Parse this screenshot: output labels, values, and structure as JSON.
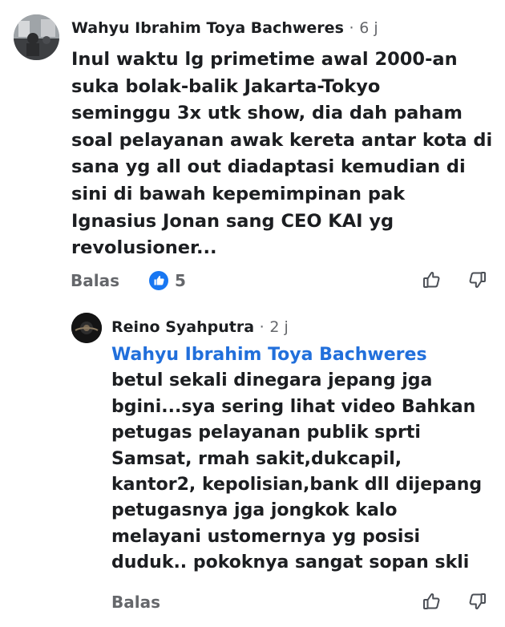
{
  "comments": [
    {
      "author": "Wahyu Ibrahim Toya Bachweres",
      "time": "6 j",
      "lines": [
        "Inul waktu lg primetime awal 2000-an",
        "suka bolak-balik Jakarta-Tokyo",
        "seminggu 3x utk show, dia dah paham",
        "soal pelayanan awak kereta antar kota di",
        "sana yg all out diadaptasi kemudian di",
        "sini di bawah kepemimpinan pak",
        "Ignasius Jonan sang CEO KAI yg",
        "revolusioner..."
      ],
      "reply_label": "Balas",
      "like_count": "5"
    },
    {
      "author": "Reino Syahputra",
      "time": "2 j",
      "mention": "Wahyu Ibrahim Toya Bachweres",
      "lines": [
        "betul sekali dinegara jepang jga",
        "bgini...sya sering lihat video Bahkan",
        "petugas pelayanan publik sprti",
        "Samsat, rmah sakit,dukcapil,",
        "kantor2, kepolisian,bank dll dijepang",
        "petugasnya jga jongkok kalo",
        "melayani ustomernya yg posisi",
        "duduk.. pokoknya sangat sopan skli"
      ],
      "reply_label": "Balas"
    }
  ],
  "separator": "·",
  "icons": {
    "like_badge": "like-badge-icon",
    "thumbs_up": "thumbs-up-icon",
    "thumbs_down": "thumbs-down-icon"
  },
  "colors": {
    "like_blue": "#1877f2",
    "mention_blue": "#216fdb",
    "muted": "#65676b",
    "text": "#1c1e21"
  }
}
